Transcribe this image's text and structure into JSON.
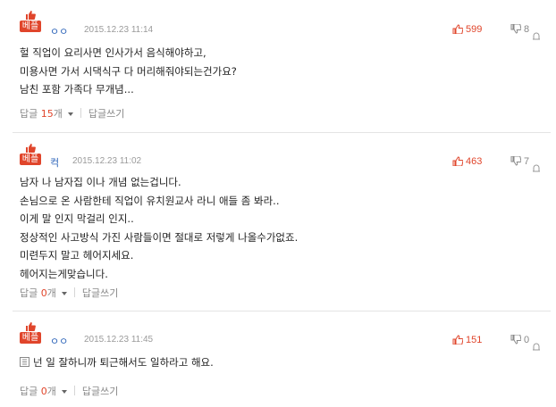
{
  "badge_label": "베플",
  "reply_label": "답글",
  "count_suffix": "개",
  "write_reply_label": "답글쓰기",
  "colors": {
    "accent": "#e0452b",
    "author": "#2a62b8",
    "meta": "#9a9a9a"
  },
  "comments": [
    {
      "author": "ㅇㅇ",
      "date": "2015.12.23 11:14",
      "likes": "599",
      "dislikes": "8",
      "lines": [
        "헐 직업이 요리사면 인사가서 음식해야하고,",
        "미용사면 가서 시댁식구 다 머리해줘야되는건가요?",
        "남친 포함 가족다 무개념..."
      ],
      "reply_count": "15"
    },
    {
      "author": "컥",
      "date": "2015.12.23 11:02",
      "likes": "463",
      "dislikes": "7",
      "lines": [
        "남자 나 남자집 이나 개념 없는겁니다.",
        "손님으로 온 사람한테 직업이 유치원교사 라니 애들 좀 봐라..",
        "이게 말 인지 막걸리 인지..",
        "정상적인 사고방식 가진 사람들이면 절대로 저렇게 나올수가없죠.",
        "미련두지 말고 헤어지세요.",
        "헤어지는게맞습니다."
      ],
      "reply_count": "0"
    },
    {
      "author": "ㅇㅇ",
      "date": "2015.12.23 11:45",
      "likes": "151",
      "dislikes": "0",
      "lines": [
        "넌 일 잘하니까 퇴근해서도 일하라고 해요."
      ],
      "reply_count": "0"
    }
  ]
}
